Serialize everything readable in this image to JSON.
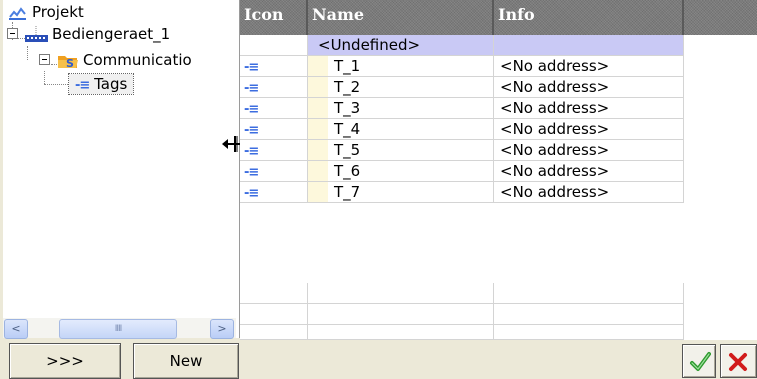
{
  "tree": {
    "root": {
      "label": "Projekt",
      "icon": "project-icon"
    },
    "device": {
      "label": "Bediengeraet_1",
      "icon": "hmi-device-icon"
    },
    "communication": {
      "label": "Communicatio",
      "icon": "communication-folder-icon"
    },
    "tags": {
      "label": "Tags",
      "icon": "tags-icon",
      "selected": true
    }
  },
  "tree_scrollbar": {
    "left_arrow": "<",
    "right_arrow": ">",
    "thumb_grip": "IIII"
  },
  "grid": {
    "columns": [
      "Icon",
      "Name",
      "Info"
    ],
    "undefined_row": {
      "name": "<Undefined>"
    },
    "rows": [
      {
        "icon": "tag-icon",
        "name": "T_1",
        "info": "<No address>"
      },
      {
        "icon": "tag-icon",
        "name": "T_2",
        "info": "<No address>"
      },
      {
        "icon": "tag-icon",
        "name": "T_3",
        "info": "<No address>"
      },
      {
        "icon": "tag-icon",
        "name": "T_4",
        "info": "<No address>"
      },
      {
        "icon": "tag-icon",
        "name": "T_5",
        "info": "<No address>"
      },
      {
        "icon": "tag-icon",
        "name": "T_6",
        "info": "<No address>"
      },
      {
        "icon": "tag-icon",
        "name": "T_7",
        "info": "<No address>"
      }
    ]
  },
  "buttons": {
    "expand": ">>>",
    "new": "New"
  },
  "colors": {
    "header": "#7b7b7b",
    "undefined_row": "#c9c9f5",
    "ok": "#2e9a2e",
    "cancel": "#d11a1a"
  }
}
